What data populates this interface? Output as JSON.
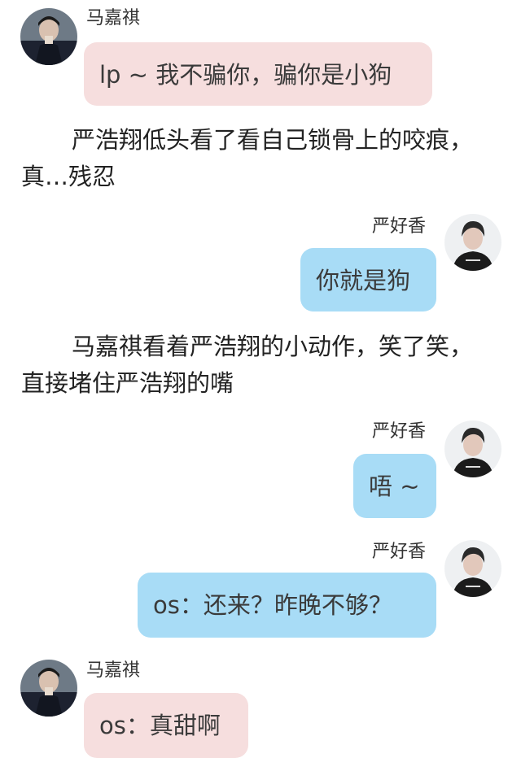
{
  "characters": {
    "left_name": "马嘉祺",
    "right_name": "严好香"
  },
  "messages": [
    {
      "side": "left",
      "name": "马嘉祺",
      "text": "lp ~ 我不骗你，骗你是小狗"
    },
    {
      "side": "right",
      "name": "严好香",
      "text": "你就是狗"
    },
    {
      "side": "right",
      "name": "严好香",
      "text": "唔 ~"
    },
    {
      "side": "right",
      "name": "严好香",
      "text": "os：还来？昨晚不够？"
    },
    {
      "side": "left",
      "name": "马嘉祺",
      "text": "os：真甜啊"
    }
  ],
  "narrations": [
    "严浩翔低头看了看自己锁骨上的咬痕，真…残忍",
    "马嘉祺看着严浩翔的小动作，笑了笑，直接堵住严浩翔的嘴"
  ],
  "colors": {
    "left_bubble": "#f6dede",
    "right_bubble": "#a8dcf6",
    "text": "#222222"
  },
  "icons": {
    "left_avatar": "avatar-ma-jiaqi-icon",
    "right_avatar": "avatar-yan-haoxiang-icon"
  }
}
